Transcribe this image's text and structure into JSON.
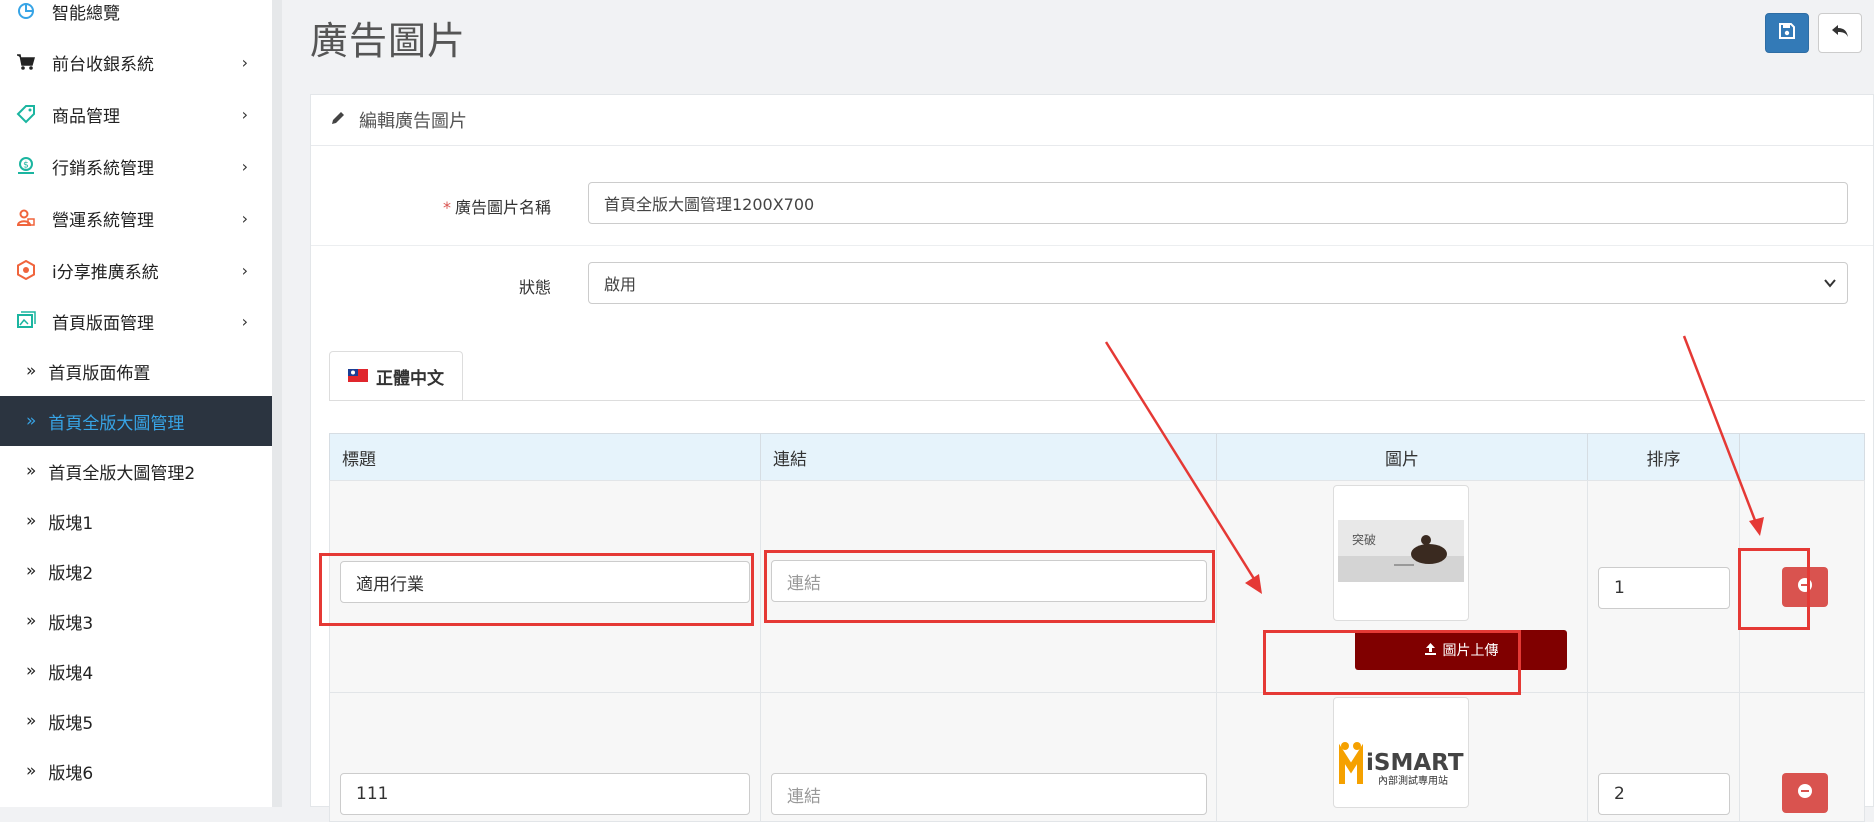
{
  "sidebar": {
    "items": [
      {
        "label": "智能總覽",
        "icon": "pie-chart-icon",
        "has_children": false
      },
      {
        "label": "前台收銀系統",
        "icon": "cart-icon",
        "has_children": true
      },
      {
        "label": "商品管理",
        "icon": "tag-icon",
        "has_children": true
      },
      {
        "label": "行銷系統管理",
        "icon": "money-hand-icon",
        "has_children": true
      },
      {
        "label": "營運系統管理",
        "icon": "user-lock-icon",
        "has_children": true
      },
      {
        "label": "i分享推廣系統",
        "icon": "badge-icon",
        "has_children": true
      },
      {
        "label": "首頁版面管理",
        "icon": "image-gallery-icon",
        "has_children": true
      }
    ],
    "sub_items": [
      {
        "label": "首頁版面佈置",
        "active": false
      },
      {
        "label": "首頁全版大圖管理",
        "active": true
      },
      {
        "label": "首頁全版大圖管理2",
        "active": false
      },
      {
        "label": "版塊1",
        "active": false
      },
      {
        "label": "版塊2",
        "active": false
      },
      {
        "label": "版塊3",
        "active": false
      },
      {
        "label": "版塊4",
        "active": false
      },
      {
        "label": "版塊5",
        "active": false
      },
      {
        "label": "版塊6",
        "active": false
      }
    ],
    "sub_prefix": "»",
    "chevron": "›"
  },
  "header": {
    "title": "廣告圖片"
  },
  "panel": {
    "title": "編輯廣告圖片",
    "name_label": "廣告圖片名稱",
    "required_mark": "*",
    "name_value": "首頁全版大圖管理1200X700",
    "status_label": "狀態",
    "status_value": "啟用",
    "tab_label": "正體中文"
  },
  "table": {
    "headers": {
      "title": "標題",
      "link": "連結",
      "image": "圖片",
      "order": "排序"
    },
    "link_placeholder": "連結",
    "upload_label": "圖片上傳",
    "rows": [
      {
        "title": "適用行業",
        "link": "",
        "order": "1",
        "thumb_text": "突破"
      },
      {
        "title": "111",
        "link": "",
        "order": "2",
        "thumb_brand": "iSMART",
        "thumb_caption": "內部測試專用站"
      }
    ]
  },
  "colors": {
    "active_bg": "#2b3440",
    "active_text": "#37a4e6",
    "upload_btn": "#800000",
    "delete_btn": "#d9534f",
    "annotation": "#e53935",
    "save_btn": "#337ab7"
  }
}
